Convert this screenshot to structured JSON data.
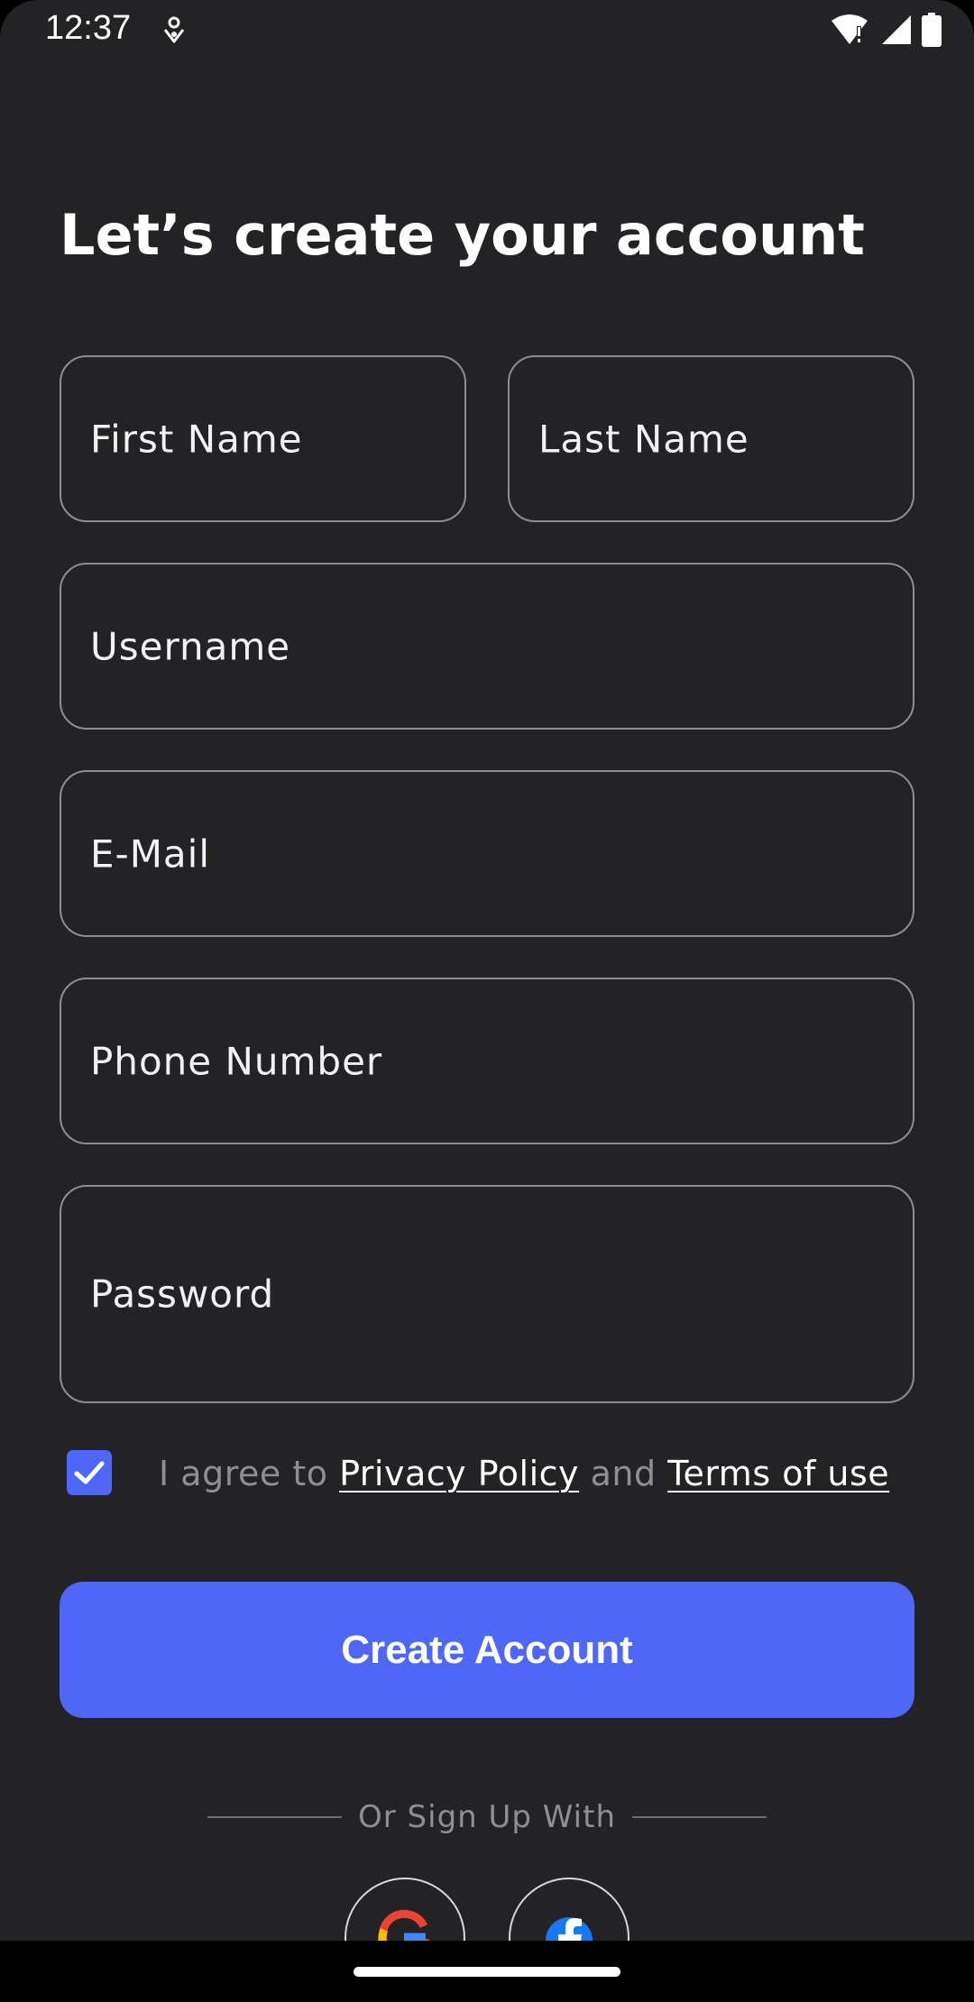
{
  "status_bar": {
    "time": "12:37"
  },
  "page": {
    "title": "Let’s create your account"
  },
  "form": {
    "first_name_placeholder": "First Name",
    "last_name_placeholder": "Last Name",
    "username_placeholder": "Username",
    "email_placeholder": "E-Mail",
    "phone_placeholder": "Phone Number",
    "password_placeholder": "Password"
  },
  "agreement": {
    "checked": true,
    "prefix": "I agree to",
    "privacy_link": "Privacy Policy",
    "conjunction": "and",
    "terms_link": "Terms of use"
  },
  "actions": {
    "create_label": "Create Account"
  },
  "divider": {
    "text": "Or Sign Up With"
  },
  "social": {
    "items": [
      "google-icon",
      "facebook-icon"
    ]
  },
  "colors": {
    "background": "#232325",
    "accent": "#4f67f7",
    "border": "#8e8e92",
    "muted_text": "#8f8f93"
  }
}
